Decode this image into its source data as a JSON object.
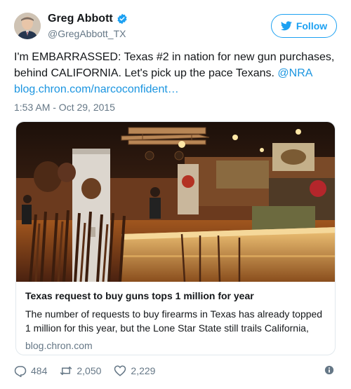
{
  "author": {
    "display_name": "Greg Abbott",
    "handle": "@GregAbbott_TX",
    "verified": true
  },
  "follow_button": {
    "label": "Follow"
  },
  "tweet": {
    "text_main": "I'm EMBARRASSED: Texas #2 in nation for new gun purchases, behind CALIFORNIA. Let's pick up the pace Texans.",
    "mention": "@NRA",
    "link": "blog.chron.com/narcoconfident…",
    "timestamp": "1:53 AM - Oct 29, 2015"
  },
  "card": {
    "title": "Texas request to buy guns tops 1 million for year",
    "description": "The number of requests to buy firearms in Texas has already topped 1 million for this year, but the Lone Star State still trails California,",
    "domain": "blog.chron.com"
  },
  "actions": {
    "replies": "484",
    "retweets": "2,050",
    "likes": "2,229"
  },
  "colors": {
    "accent": "#1da1f2",
    "link": "#1b95e0",
    "muted": "#657786",
    "border": "#e1e8ed"
  },
  "icons": [
    "verified-badge-icon",
    "twitter-bird-icon",
    "reply-icon",
    "retweet-icon",
    "like-heart-icon",
    "info-icon"
  ]
}
